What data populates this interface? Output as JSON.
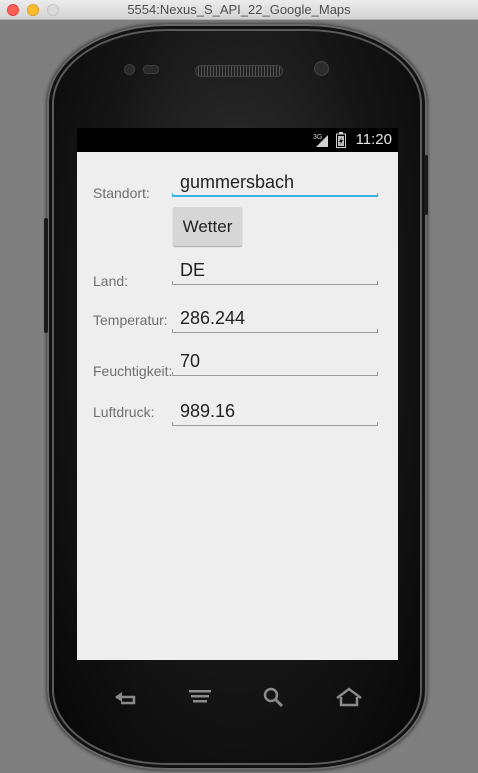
{
  "window": {
    "title": "5554:Nexus_S_API_22_Google_Maps"
  },
  "status_bar": {
    "network": "3G",
    "time": "11:20"
  },
  "form": {
    "standort_label": "Standort:",
    "standort_value": "gummersbach",
    "button_label": "Wetter",
    "land_label": "Land:",
    "land_value": "DE",
    "temperatur_label": "Temperatur:",
    "temperatur_value": "286.244",
    "feuchtigkeit_label": "Feuchtigkeit:",
    "feuchtigkeit_value": "70",
    "luftdruck_label": "Luftdruck:",
    "luftdruck_value": "989.16"
  },
  "nav_bar": {
    "icons": [
      "back-icon",
      "menu-icon",
      "search-icon",
      "home-icon"
    ]
  }
}
